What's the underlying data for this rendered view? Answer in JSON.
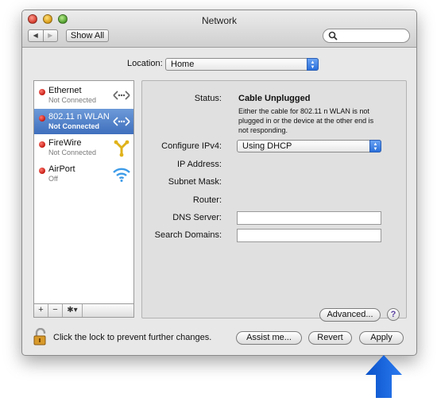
{
  "window": {
    "title": "Network"
  },
  "toolbar": {
    "show_all_label": "Show All",
    "back_glyph": "◀",
    "forward_glyph": "▶"
  },
  "search": {
    "placeholder": "",
    "icon": "search-icon"
  },
  "location": {
    "label": "Location:",
    "value": "Home"
  },
  "services": [
    {
      "name": "Ethernet",
      "status": "Not Connected",
      "indicator": "red",
      "icon": "ethernet-icon",
      "selected": false
    },
    {
      "name": "802.11 n WLAN",
      "status": "Not Connected",
      "indicator": "red",
      "icon": "ethernet-icon",
      "selected": true
    },
    {
      "name": "FireWire",
      "status": "Not Connected",
      "indicator": "red",
      "icon": "firewire-icon",
      "selected": false
    },
    {
      "name": "AirPort",
      "status": "Off",
      "indicator": "red",
      "icon": "airport-icon",
      "selected": false
    }
  ],
  "service_toolbar": {
    "add": "+",
    "remove": "−",
    "gear": "✱▾"
  },
  "detail": {
    "status_label": "Status:",
    "status_value": "Cable Unplugged",
    "status_description": "Either the cable for 802.11 n WLAN is not plugged in or the device at the other end is not responding.",
    "configure_label": "Configure IPv4:",
    "configure_value": "Using DHCP",
    "ip_label": "IP Address:",
    "subnet_label": "Subnet Mask:",
    "router_label": "Router:",
    "dns_label": "DNS Server:",
    "dns_value": "",
    "search_domains_label": "Search Domains:",
    "search_domains_value": "",
    "advanced_label": "Advanced...",
    "help_label": "?"
  },
  "footer": {
    "lock_text": "Click the lock to prevent further changes.",
    "assist_label": "Assist me...",
    "revert_label": "Revert",
    "apply_label": "Apply"
  },
  "colors": {
    "selection": "#3f6fbd",
    "status_red": "#c0120a",
    "arrow_blue": "#1a6bd8",
    "popup_blue": "#2a6fdb"
  }
}
